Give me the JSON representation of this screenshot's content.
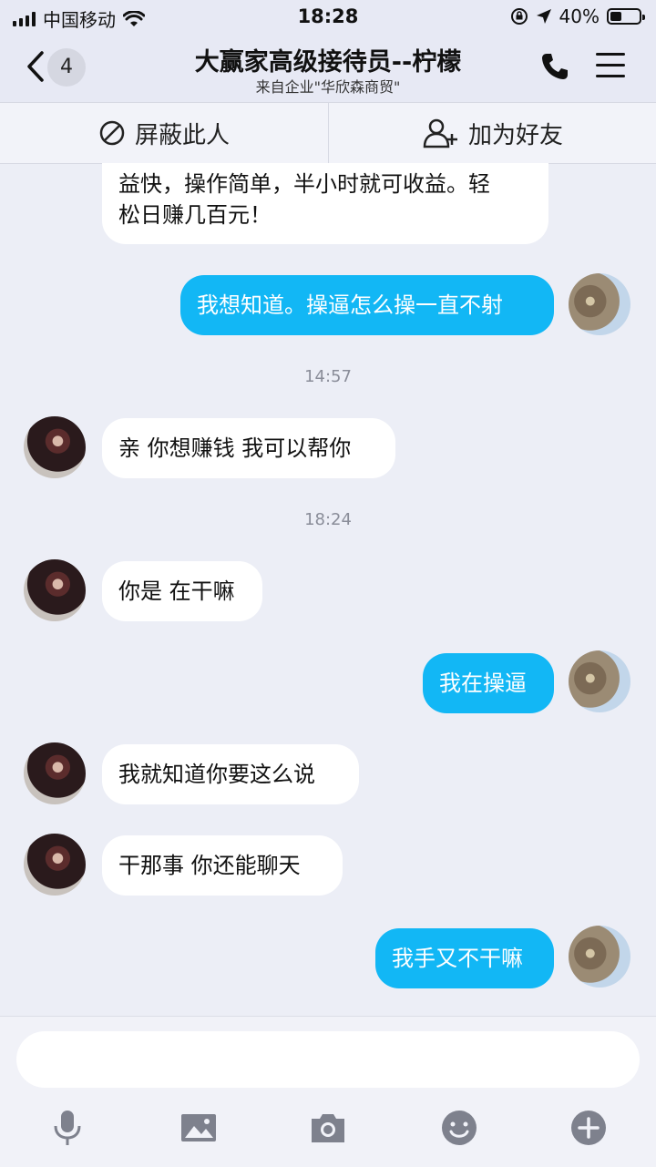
{
  "status_bar": {
    "carrier": "中国移动",
    "time": "18:28",
    "battery": "40%",
    "battery_level": 0.4
  },
  "header": {
    "unread_count": "4",
    "title": "大赢家高级接待员--柠檬",
    "subtitle": "来自企业\"华欣森商贸\""
  },
  "actions": {
    "block_label": "屏蔽此人",
    "add_friend_label": "加为好友"
  },
  "messages": [
    {
      "side": "in",
      "text_line1": "益快，操作简单，半小时就可收益。轻",
      "text_line2": "松日赚几百元！"
    },
    {
      "side": "out",
      "text": "我想知道。操逼怎么操一直不射"
    },
    {
      "side": "in",
      "text": "亲 你想赚钱 我可以帮你"
    },
    {
      "side": "in",
      "text": "你是 在干嘛"
    },
    {
      "side": "out",
      "text": "我在操逼"
    },
    {
      "side": "in",
      "text": "我就知道你要这么说"
    },
    {
      "side": "in",
      "text": "干那事 你还能聊天"
    },
    {
      "side": "out",
      "text": "我手又不干嘛"
    }
  ],
  "timestamps": [
    "14:57",
    "18:24"
  ],
  "input": {
    "value": "",
    "placeholder": ""
  },
  "colors": {
    "accent": "#12b7f5",
    "background": "#eceef6"
  }
}
